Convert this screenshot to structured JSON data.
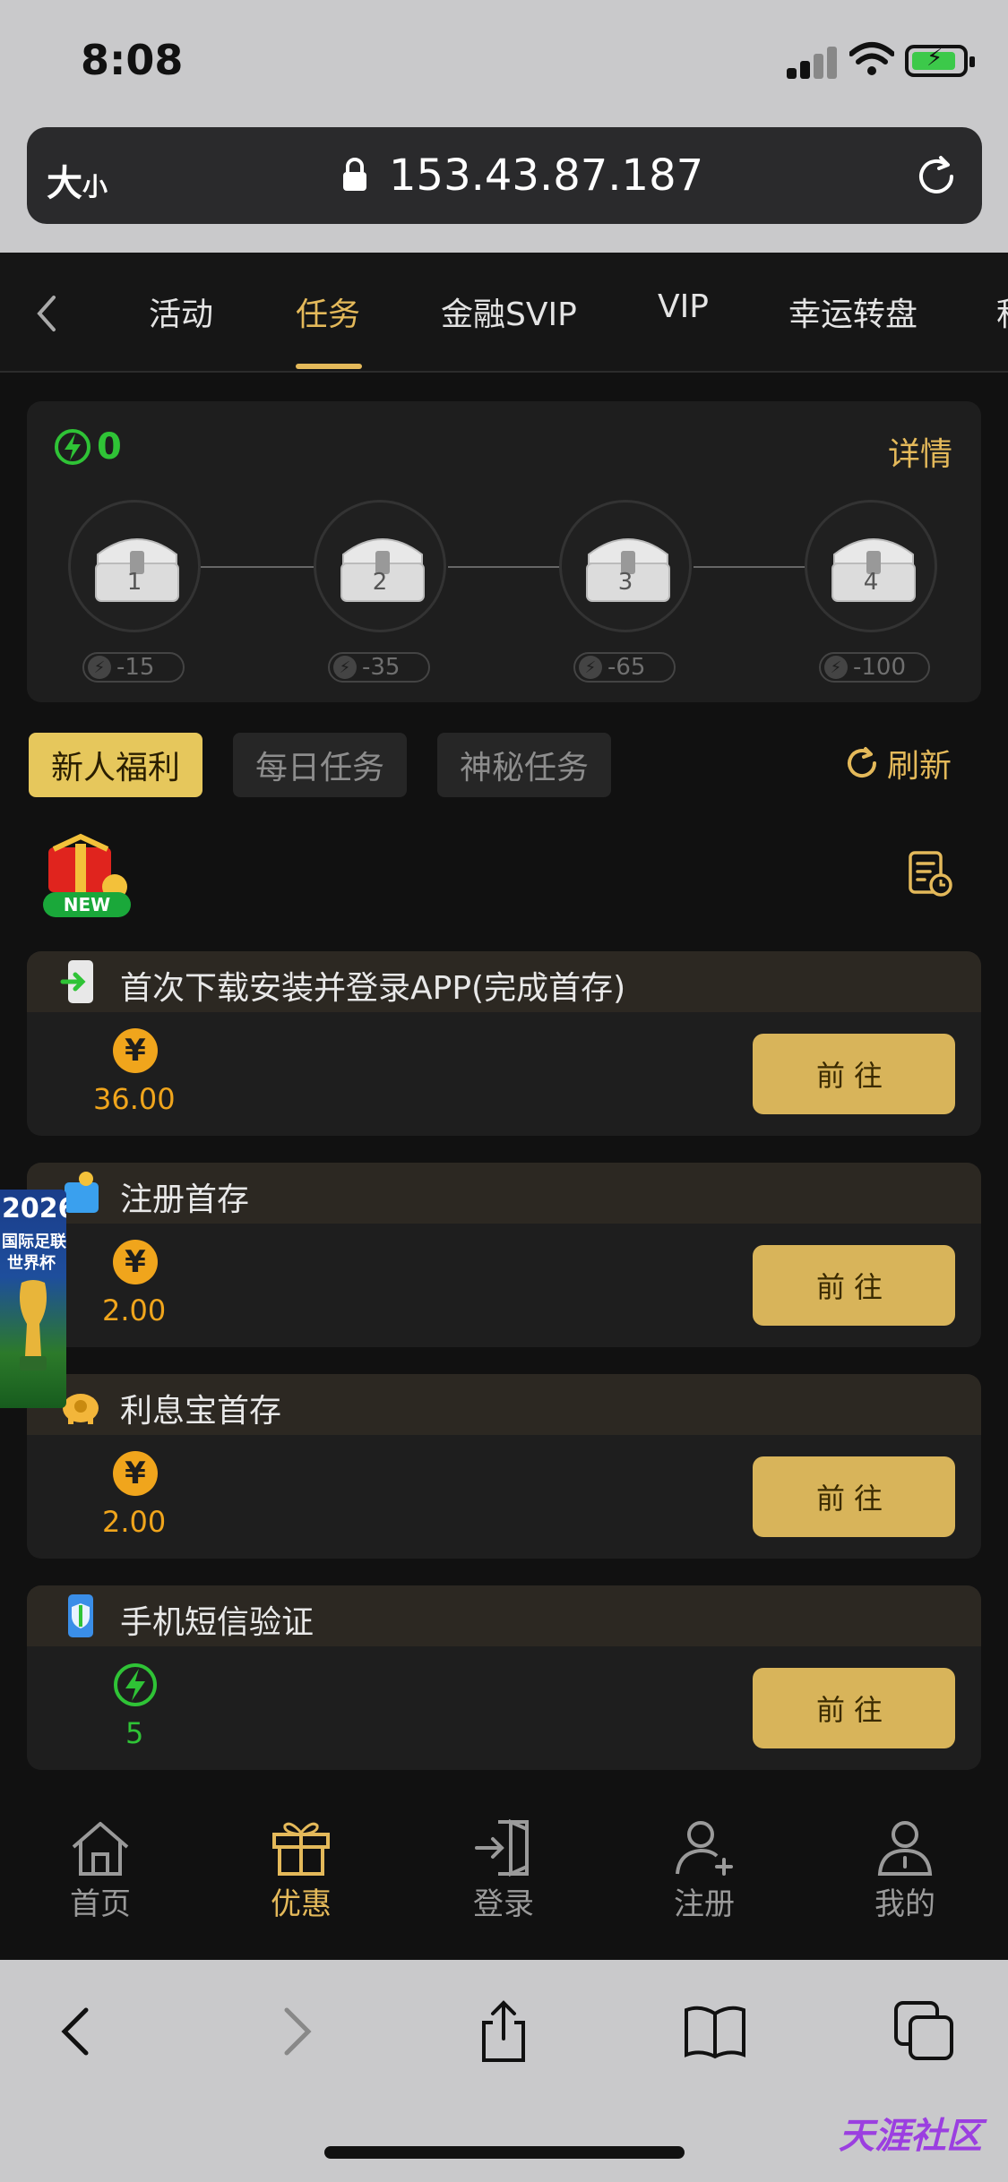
{
  "status": {
    "time": "8:08"
  },
  "browser": {
    "size_label_big": "大",
    "size_label_small": "小",
    "url": "153.43.87.187"
  },
  "tabs": [
    "活动",
    "任务",
    "金融SVIP",
    "VIP",
    "幸运转盘",
    "积"
  ],
  "active_tab": "任务",
  "energy": {
    "value": "0",
    "detail_label": "详情"
  },
  "chests": [
    {
      "number": "1",
      "cost": "-15"
    },
    {
      "number": "2",
      "cost": "-35"
    },
    {
      "number": "3",
      "cost": "-65"
    },
    {
      "number": "4",
      "cost": "-100"
    }
  ],
  "filters": [
    "新人福利",
    "每日任务",
    "神秘任务"
  ],
  "active_filter": "新人福利",
  "refresh_label": "刷新",
  "new_badge": "NEW",
  "tasks": [
    {
      "title": "首次下载安装并登录APP(完成首存)",
      "coin_symbol": "¥",
      "reward": "36.00",
      "reward_type": "coin",
      "action": "前往",
      "icon": "app-download-icon"
    },
    {
      "title": "注册首存",
      "coin_symbol": "¥",
      "reward": "2.00",
      "reward_type": "coin",
      "action": "前往",
      "icon": "wallet-icon"
    },
    {
      "title": "利息宝首存",
      "coin_symbol": "¥",
      "reward": "2.00",
      "reward_type": "coin",
      "action": "前往",
      "icon": "piggy-bank-icon"
    },
    {
      "title": "手机短信验证",
      "coin_symbol": "",
      "reward": "5",
      "reward_type": "energy",
      "action": "前往",
      "icon": "phone-shield-icon"
    }
  ],
  "worldcup": {
    "year": "2026",
    "line1": "国际足联",
    "line2": "世界杯"
  },
  "bottom_nav": [
    {
      "label": "首页",
      "icon": "home-icon"
    },
    {
      "label": "优惠",
      "icon": "gift-icon",
      "active": true
    },
    {
      "label": "登录",
      "icon": "login-icon"
    },
    {
      "label": "注册",
      "icon": "add-user-icon"
    },
    {
      "label": "我的",
      "icon": "profile-icon"
    }
  ],
  "watermark": "天涯社区",
  "colors": {
    "accent": "#e4b95a",
    "energy_green": "#2fc336",
    "coin_orange": "#f0a51c",
    "button_gold": "#d8b45a",
    "chip_active": "#e6c75c"
  }
}
